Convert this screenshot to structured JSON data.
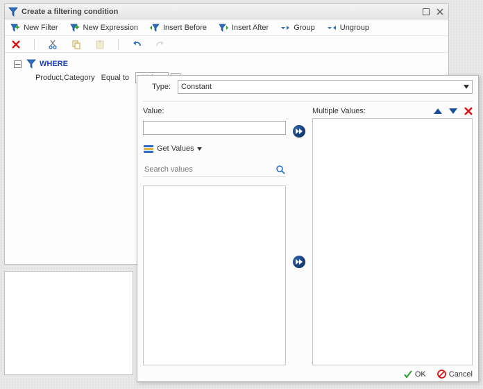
{
  "window": {
    "title": "Create a filtering condition"
  },
  "toolbar1": {
    "new_filter": "New Filter",
    "new_expression": "New Expression",
    "insert_before": "Insert Before",
    "insert_after": "Insert After",
    "group": "Group",
    "ungroup": "Ungroup"
  },
  "tree": {
    "where": "WHERE",
    "condition_field": "Product,Category",
    "condition_op": "Equal to",
    "condition_value_placeholder": "<Value>"
  },
  "popup": {
    "type_label": "Type:",
    "type_value": "Constant",
    "value_label": "Value:",
    "value_input": "",
    "get_values": "Get Values",
    "search_placeholder": "Search values",
    "multiple_values_label": "Multiple Values:",
    "ok": "OK",
    "cancel": "Cancel"
  }
}
